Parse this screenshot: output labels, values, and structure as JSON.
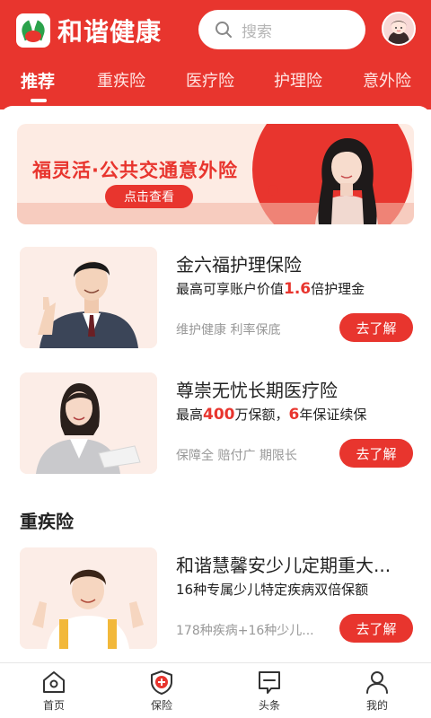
{
  "brand": {
    "name": "和谐健康"
  },
  "search": {
    "placeholder": "搜索"
  },
  "tabs": [
    "推荐",
    "重疾险",
    "医疗险",
    "护理险",
    "意外险"
  ],
  "banner": {
    "title": "福灵活·公共交通意外险",
    "button": "点击查看"
  },
  "products": [
    {
      "title": "金六福护理保险",
      "desc_pre": "最高可享账户价值",
      "desc_hl": "1.6",
      "desc_post": "倍护理金",
      "tags": "维护健康  利率保底",
      "cta": "去了解"
    },
    {
      "title": "尊崇无忧长期医疗险",
      "desc_pre": "最高",
      "desc_hl": "400",
      "desc_mid": "万保额，",
      "desc_hl2": "6",
      "desc_post": "年保证续保",
      "tags": "保障全  赔付广  期限长",
      "cta": "去了解"
    },
    {
      "title": "和谐慧馨安少儿定期重大...",
      "desc_pre": "16种专属少儿特定疾病双倍保额",
      "tags": "178种疾病+16种少儿...",
      "cta": "去了解"
    }
  ],
  "section": {
    "critical_illness": "重疾险"
  },
  "bottom_nav": [
    {
      "label": "首页",
      "icon": "home-icon"
    },
    {
      "label": "保险",
      "icon": "shield-plus-icon"
    },
    {
      "label": "头条",
      "icon": "headline-icon"
    },
    {
      "label": "我的",
      "icon": "user-icon"
    }
  ],
  "colors": {
    "brand_red": "#e8352e",
    "text": "#222222",
    "muted": "#999999"
  }
}
